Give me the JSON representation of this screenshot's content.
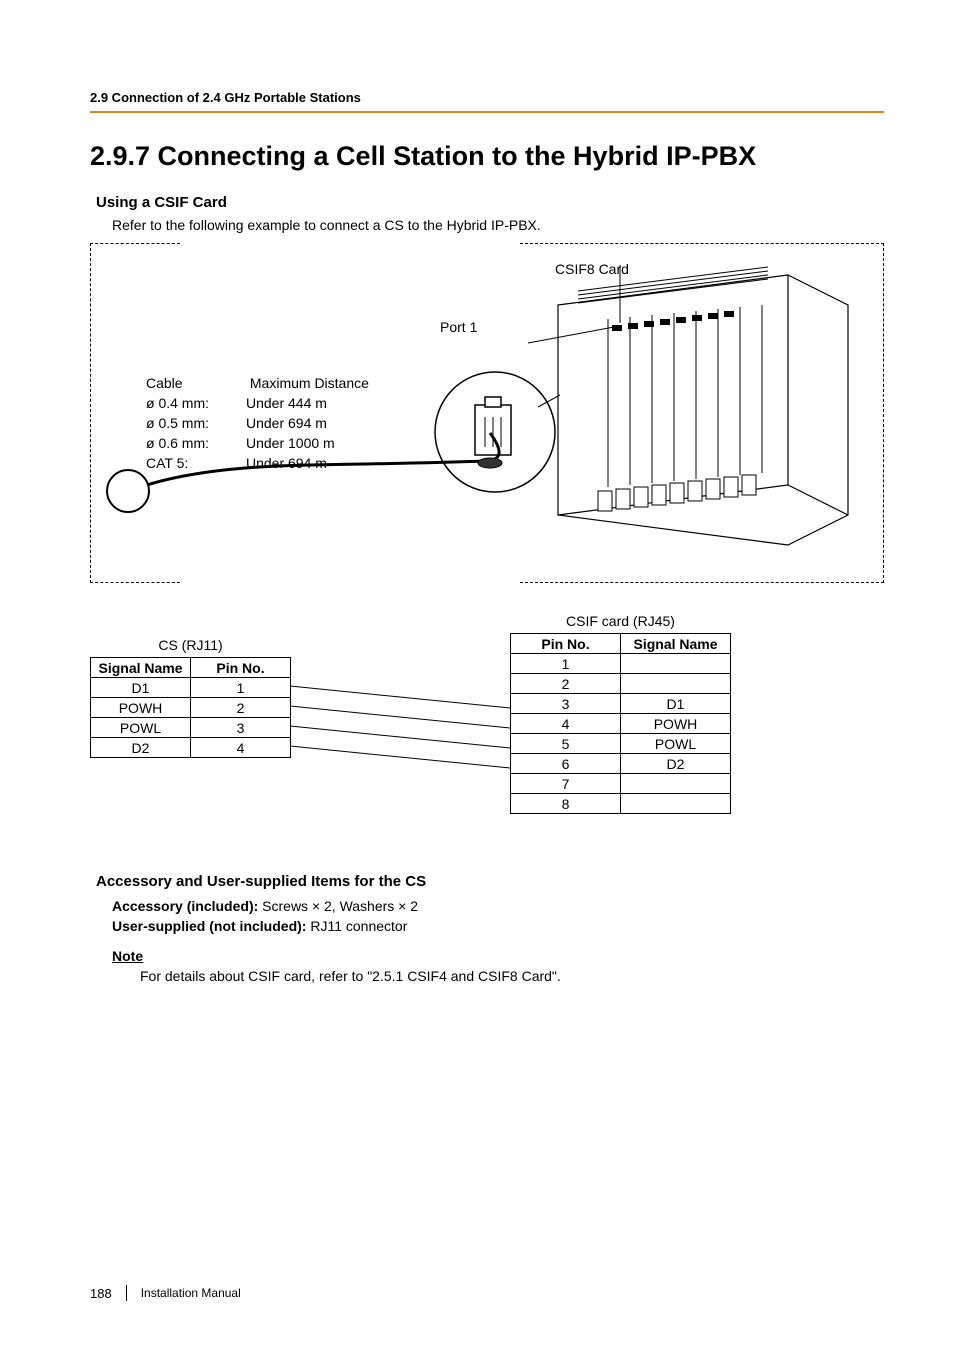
{
  "header": {
    "section": "2.9 Connection of 2.4 GHz Portable Stations"
  },
  "title": "2.9.7   Connecting a Cell Station to the Hybrid IP-PBX",
  "using_csif": {
    "heading": "Using a CSIF Card",
    "lead": "Refer to the following example to connect a CS to the Hybrid IP-PBX."
  },
  "diagram": {
    "csif_card_label": "CSIF8 Card",
    "port_label": "Port 1",
    "cable_heading_col1": "Cable",
    "cable_heading_col2": "Maximum Distance",
    "cable_rows": [
      {
        "label": "ø 0.4 mm:",
        "dist": "Under 444 m"
      },
      {
        "label": "ø 0.5 mm:",
        "dist": "Under 694 m"
      },
      {
        "label": "ø 0.6 mm:",
        "dist": "Under 1000 m"
      },
      {
        "label": "CAT 5:",
        "dist": "Under 694 m"
      }
    ]
  },
  "table_cs": {
    "caption": "CS (RJ11)",
    "col1": "Signal Name",
    "col2": "Pin No.",
    "rows": [
      {
        "sig": "D1",
        "pin": "1"
      },
      {
        "sig": "POWH",
        "pin": "2"
      },
      {
        "sig": "POWL",
        "pin": "3"
      },
      {
        "sig": "D2",
        "pin": "4"
      }
    ]
  },
  "table_csif": {
    "caption": "CSIF card (RJ45)",
    "col1": "Pin No.",
    "col2": "Signal Name",
    "rows": [
      {
        "pin": "1",
        "sig": ""
      },
      {
        "pin": "2",
        "sig": ""
      },
      {
        "pin": "3",
        "sig": "D1"
      },
      {
        "pin": "4",
        "sig": "POWH"
      },
      {
        "pin": "5",
        "sig": "POWL"
      },
      {
        "pin": "6",
        "sig": "D2"
      },
      {
        "pin": "7",
        "sig": ""
      },
      {
        "pin": "8",
        "sig": ""
      }
    ]
  },
  "accessory": {
    "heading": "Accessory and User-supplied Items for the CS",
    "inc_label": "Accessory (included): ",
    "inc_value": "Screws × 2, Washers × 2",
    "usup_label": "User-supplied (not included): ",
    "usup_value": "RJ11 connector"
  },
  "note": {
    "heading": "Note",
    "body": "For details about CSIF card, refer to \"2.5.1 CSIF4 and CSIF8 Card\"."
  },
  "footer": {
    "page": "188",
    "doc": "Installation Manual"
  }
}
